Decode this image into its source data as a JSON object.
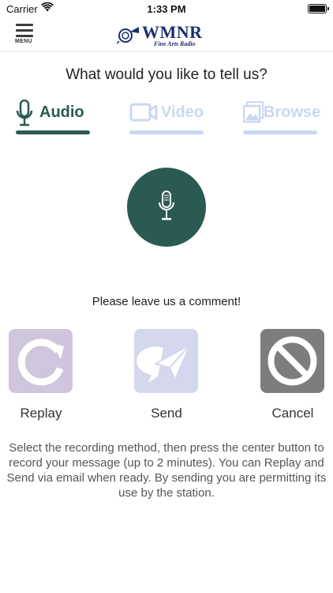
{
  "status_bar": {
    "carrier": "Carrier",
    "time": "1:33 PM",
    "battery_level": 1.0
  },
  "header": {
    "menu_label": "MENU",
    "logo_title": "WMNR",
    "logo_subtitle": "Fine Arts Radio",
    "brand_color": "#1d2f6e"
  },
  "prompt": "What would you like to tell us?",
  "tabs": [
    {
      "label": "Audio",
      "icon": "microphone-icon",
      "active": true,
      "color": "#2a5a52"
    },
    {
      "label": "Video",
      "icon": "video-camera-icon",
      "active": false,
      "color": "#c9d8f2"
    },
    {
      "label": "Browse",
      "icon": "gallery-icon",
      "active": false,
      "color": "#c9d8f2"
    }
  ],
  "record_button": {
    "icon": "microphone-icon",
    "color": "#2a5a52"
  },
  "comment_prompt": "Please leave us a comment!",
  "actions": [
    {
      "label": "Replay",
      "icon": "replay-icon",
      "color": "#cfc5dc"
    },
    {
      "label": "Send",
      "icon": "send-icon",
      "color": "#d5d7ec"
    },
    {
      "label": "Cancel",
      "icon": "cancel-icon",
      "color": "#7d7d7d"
    }
  ],
  "instructions": "Select the recording method, then press the center button to record your message (up to 2 minutes). You can Replay and Send via email when ready. By sending you are permitting its use by the station."
}
